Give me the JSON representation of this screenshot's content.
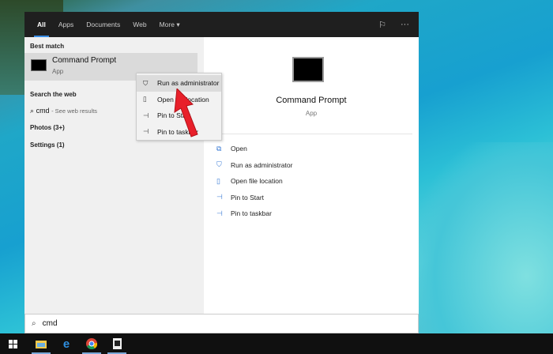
{
  "tabs": [
    "All",
    "Apps",
    "Documents",
    "Web",
    "More"
  ],
  "left": {
    "best_match": "Best match",
    "app_title": "Command Prompt",
    "app_type": "App",
    "search_web": "Search the web",
    "web_query": "cmd",
    "web_hint": "- See web results",
    "photos": "Photos (3+)",
    "settings": "Settings (1)"
  },
  "context_menu": [
    "Run as administrator",
    "Open file location",
    "Pin to Start",
    "Pin to taskbar"
  ],
  "right": {
    "title": "Command Prompt",
    "subtitle": "App",
    "actions": [
      "Open",
      "Run as administrator",
      "Open file location",
      "Pin to Start",
      "Pin to taskbar"
    ]
  },
  "search": {
    "value": "cmd"
  },
  "colors": {
    "accent": "#3a8ee6",
    "arrow": "#e8202a"
  }
}
